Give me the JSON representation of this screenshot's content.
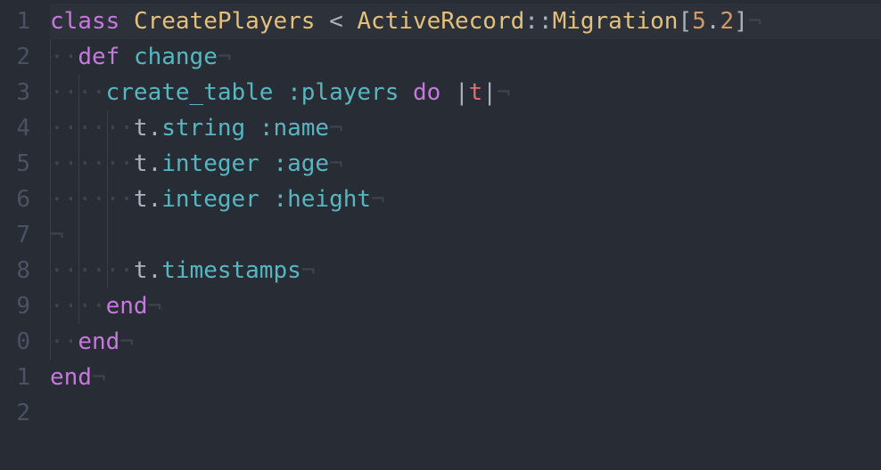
{
  "editor": {
    "line_numbers": [
      "1",
      "2",
      "3",
      "4",
      "5",
      "6",
      "7",
      "8",
      "9",
      "0",
      "1",
      "2"
    ],
    "invisibles": {
      "space": "·",
      "newline": "¬"
    },
    "tokens": {
      "kw_class": "class",
      "cls_create_players": "CreatePlayers",
      "op_lt": "<",
      "cls_active_record": "ActiveRecord",
      "dcolon": "::",
      "const_migration": "Migration",
      "br_open": "[",
      "num_5": "5",
      "dot": ".",
      "num_2": "2",
      "br_close": "]",
      "kw_def": "def",
      "id_change": "change",
      "id_create_table": "create_table",
      "sym_players": ":players",
      "kw_do": "do",
      "pipe": "|",
      "var_t": "t",
      "t_ref": "t",
      "id_string": "string",
      "sym_name": ":name",
      "id_integer": "integer",
      "sym_age": ":age",
      "sym_height": ":height",
      "id_timestamps": "timestamps",
      "kw_end": "end"
    }
  }
}
